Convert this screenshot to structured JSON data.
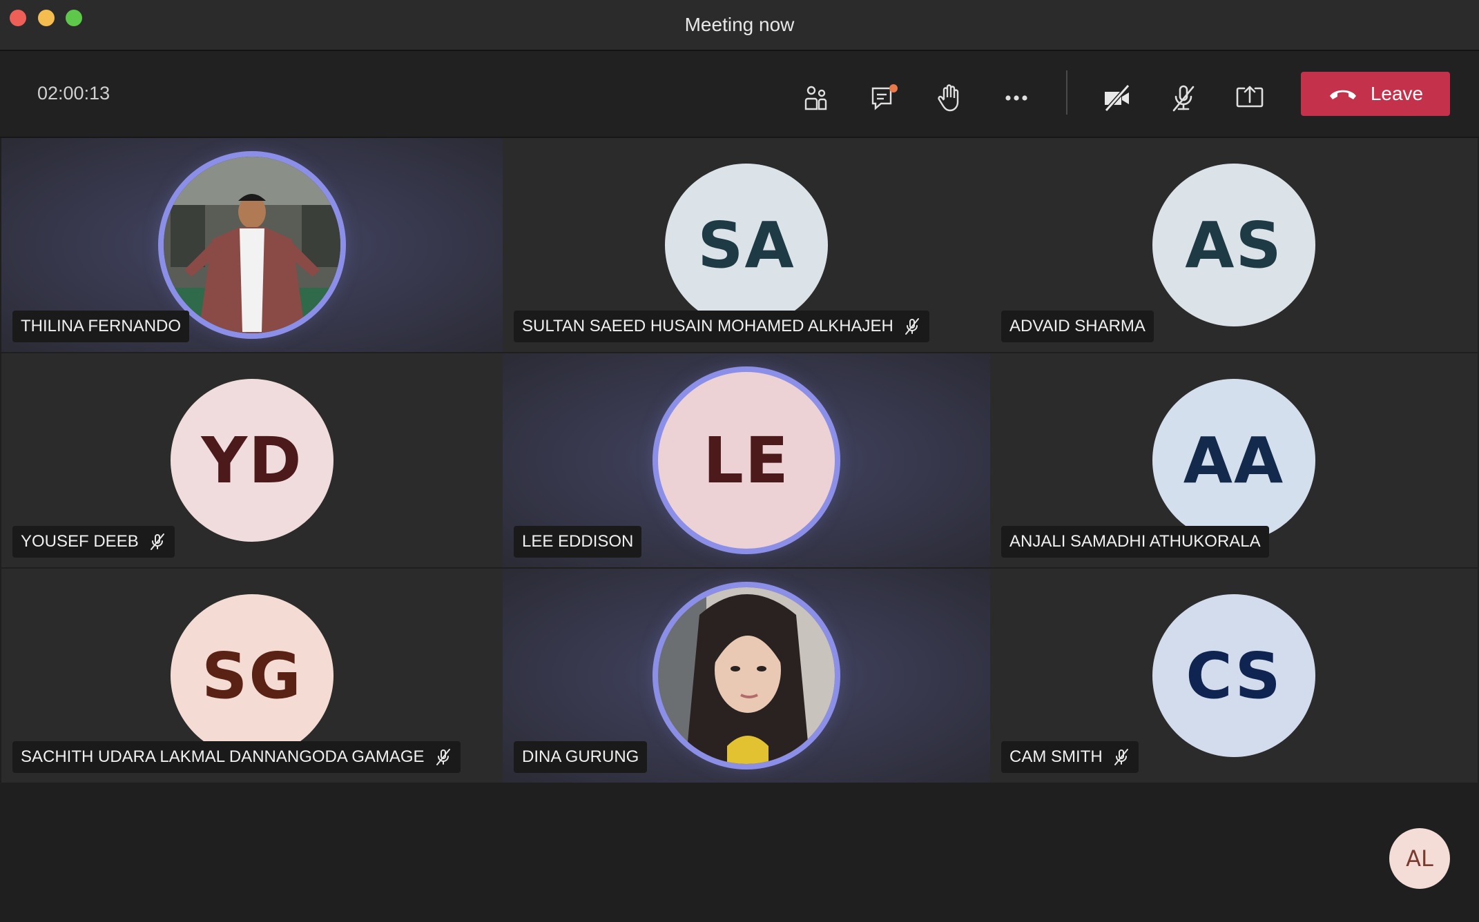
{
  "window": {
    "title": "Meeting now"
  },
  "toolbar": {
    "timer": "02:00:13",
    "buttons": [
      "participants-icon",
      "chat-icon",
      "raise-hand-icon",
      "more-options-icon",
      "camera-off-icon",
      "mic-off-icon",
      "share-screen-icon"
    ],
    "leave_label": "Leave"
  },
  "colors": {
    "leave": "#c4314b",
    "speaking_ring": "#8c8fe8",
    "tile_bg": "#2b2b2b",
    "chat_badge": "#e8794a"
  },
  "participants": [
    {
      "name": "THILINA FERNANDO",
      "initials": "",
      "muted": false,
      "speaking": true,
      "has_photo": true
    },
    {
      "name": "SULTAN SAEED HUSAIN MOHAMED ALKHAJEH",
      "initials": "SA",
      "muted": true,
      "speaking": false,
      "bg": "#dbe3e8",
      "fg": "#1e3a44"
    },
    {
      "name": "ADVAID SHARMA",
      "initials": "AS",
      "muted": false,
      "speaking": false,
      "bg": "#dbe3e8",
      "fg": "#1e3a44"
    },
    {
      "name": "YOUSEF DEEB",
      "initials": "YD",
      "muted": true,
      "speaking": false,
      "bg": "#f0dcdc",
      "fg": "#4c1a1a"
    },
    {
      "name": "LEE EDDISON",
      "initials": "LE",
      "muted": false,
      "speaking": true,
      "bg": "#ecd2d5",
      "fg": "#4c1a1a"
    },
    {
      "name": "ANJALI SAMADHI ATHUKORALA",
      "initials": "AA",
      "muted": false,
      "speaking": false,
      "bg": "#d3dfec",
      "fg": "#142a4c"
    },
    {
      "name": "SACHITH UDARA LAKMAL DANNANGODA GAMAGE",
      "initials": "SG",
      "muted": true,
      "speaking": false,
      "bg": "#f4dcd4",
      "fg": "#5a2214"
    },
    {
      "name": "DINA GURUNG",
      "initials": "",
      "muted": false,
      "speaking": true,
      "has_photo": true
    },
    {
      "name": "CAM SMITH",
      "initials": "CS",
      "muted": true,
      "speaking": false,
      "bg": "#d3dcec",
      "fg": "#0f2450"
    }
  ],
  "self": {
    "initials": "AL"
  }
}
